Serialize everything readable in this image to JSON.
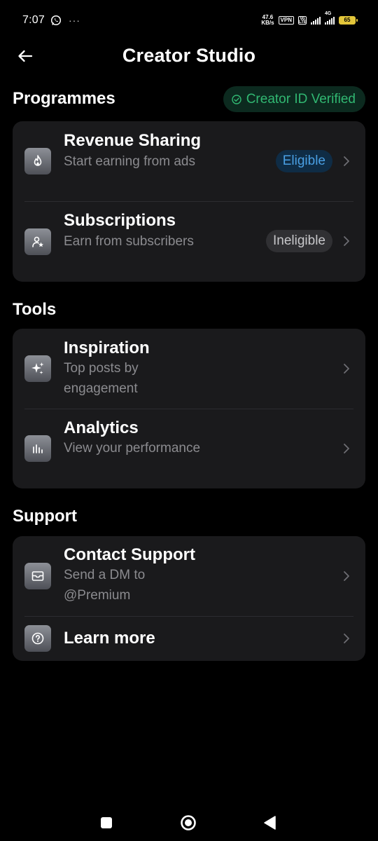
{
  "status_bar": {
    "time": "7:07",
    "net_speed_value": "47.6",
    "net_speed_unit": "KB/s",
    "vpn": "VPN",
    "lte_label": "Vo LTE",
    "network": "4G",
    "battery": "65",
    "battery_color": "#e3c63a"
  },
  "header": {
    "title": "Creator Studio",
    "back_icon": "arrow-left-icon"
  },
  "programmes": {
    "title": "Programmes",
    "badge": "Creator ID Verified",
    "badge_color": "#31b872",
    "items": [
      {
        "title": "Revenue Sharing",
        "subtitle": "Start earning from ads",
        "status": "Eligible",
        "status_color": "#4a9fe3",
        "icon": "flame-icon"
      },
      {
        "title": "Subscriptions",
        "subtitle": "Earn from subscribers",
        "status": "Ineligible",
        "icon": "person-star-icon"
      }
    ]
  },
  "tools": {
    "title": "Tools",
    "items": [
      {
        "title": "Inspiration",
        "subtitle": "Top posts by engagement",
        "icon": "sparkle-icon"
      },
      {
        "title": "Analytics",
        "subtitle": "View your performance",
        "icon": "bar-chart-icon"
      }
    ]
  },
  "support": {
    "title": "Support",
    "items": [
      {
        "title": "Contact Support",
        "subtitle": "Send a DM to @Premium",
        "icon": "envelope-icon"
      },
      {
        "title": "Learn more",
        "icon": "question-circle-icon"
      }
    ]
  },
  "nav": {
    "recents_icon": "square-icon",
    "home_icon": "circle-icon",
    "back_icon": "triangle-back-icon"
  }
}
